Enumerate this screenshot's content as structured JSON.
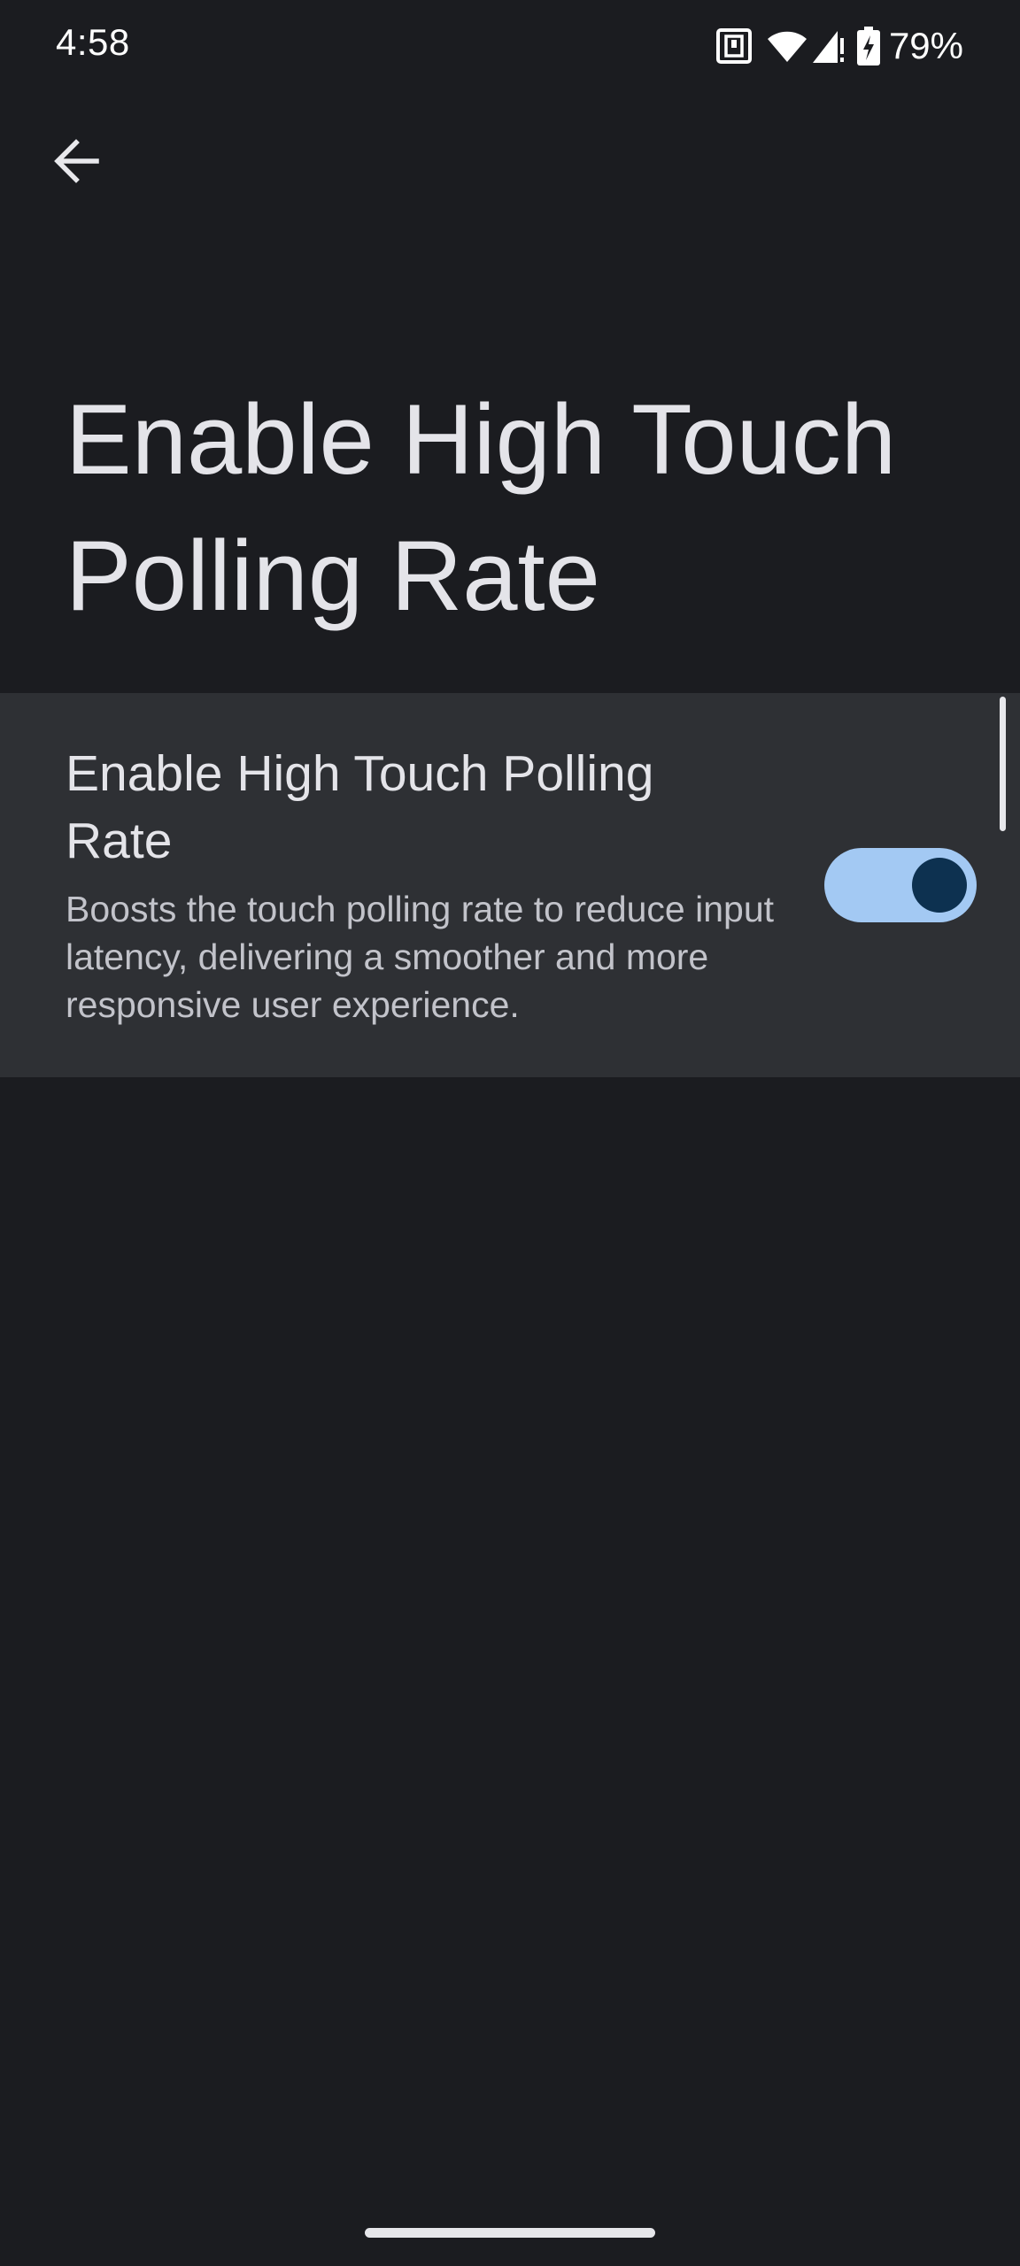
{
  "status_bar": {
    "time": "4:58",
    "icons": [
      "nfc-icon",
      "wifi-icon",
      "cell-signal-icon",
      "battery-charging-icon"
    ],
    "battery_percent": "79%"
  },
  "header": {
    "back_icon": "arrow-back-icon"
  },
  "page": {
    "title": "Enable High Touch Polling Rate"
  },
  "setting": {
    "title": "Enable High Touch Polling Rate",
    "summary": "Boosts the touch polling rate to reduce input latency, delivering a smoother and more responsive user experience.",
    "toggle_on": true
  },
  "colors": {
    "background": "#1b1c20",
    "card": "#2e3034",
    "toggle_track": "#a3c9f3",
    "toggle_knob": "#0d3150"
  }
}
